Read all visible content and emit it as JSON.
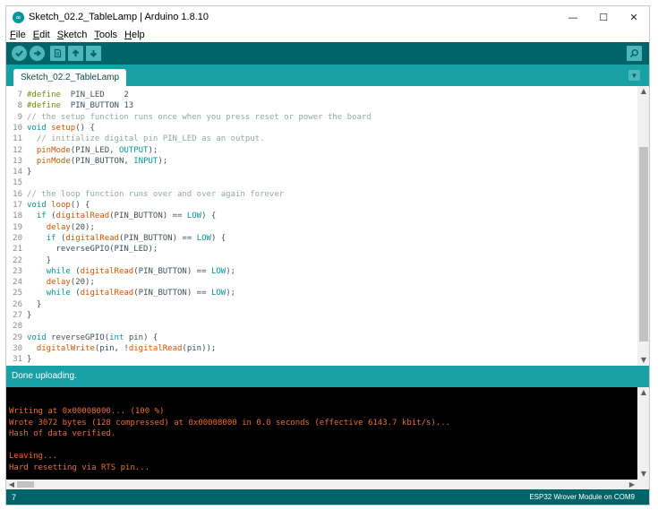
{
  "window": {
    "title": "Sketch_02.2_TableLamp | Arduino 1.8.10",
    "icon": "arduino-logo-icon",
    "controls": {
      "minimize": "—",
      "maximize": "☐",
      "close": "✕"
    }
  },
  "menubar": {
    "items": [
      {
        "ul": "F",
        "rest": "ile"
      },
      {
        "ul": "E",
        "rest": "dit"
      },
      {
        "ul": "S",
        "rest": "ketch"
      },
      {
        "ul": "T",
        "rest": "ools"
      },
      {
        "ul": "H",
        "rest": "elp"
      }
    ]
  },
  "toolbar": {
    "verify_icon": "checkmark-icon",
    "upload_icon": "arrow-right-icon",
    "new_icon": "new-file-icon",
    "open_icon": "arrow-up-icon",
    "save_icon": "arrow-down-icon",
    "serial_monitor_icon": "magnifier-icon"
  },
  "tabs": [
    {
      "label": "Sketch_02.2_TableLamp",
      "active": true
    }
  ],
  "editor": {
    "lines": [
      {
        "n": "7",
        "parts": [
          [
            "pp",
            "#define"
          ],
          [
            "",
            "  PIN_LED    2"
          ]
        ]
      },
      {
        "n": "8",
        "parts": [
          [
            "pp",
            "#define"
          ],
          [
            "",
            "  PIN_BUTTON 13"
          ]
        ]
      },
      {
        "n": "9",
        "parts": [
          [
            "c",
            "// the setup function runs once when you press reset or power the board"
          ]
        ]
      },
      {
        "n": "10",
        "parts": [
          [
            "k",
            "void"
          ],
          [
            "",
            " "
          ],
          [
            "f",
            "setup"
          ],
          [
            "",
            "() {"
          ]
        ]
      },
      {
        "n": "11",
        "parts": [
          [
            "c",
            "  // initialize digital pin PIN_LED as an output."
          ]
        ]
      },
      {
        "n": "12",
        "parts": [
          [
            "",
            "  "
          ],
          [
            "f",
            "pinMode"
          ],
          [
            "",
            "(PIN_LED, "
          ],
          [
            "k",
            "OUTPUT"
          ],
          [
            "",
            ");"
          ]
        ]
      },
      {
        "n": "13",
        "parts": [
          [
            "",
            "  "
          ],
          [
            "f",
            "pinMode"
          ],
          [
            "",
            "(PIN_BUTTON, "
          ],
          [
            "k",
            "INPUT"
          ],
          [
            "",
            ");"
          ]
        ]
      },
      {
        "n": "14",
        "parts": [
          [
            "",
            "}"
          ]
        ]
      },
      {
        "n": "15",
        "parts": []
      },
      {
        "n": "16",
        "parts": [
          [
            "c",
            "// the loop function runs over and over again forever"
          ]
        ]
      },
      {
        "n": "17",
        "parts": [
          [
            "k",
            "void"
          ],
          [
            "",
            " "
          ],
          [
            "f",
            "loop"
          ],
          [
            "",
            "() {"
          ]
        ]
      },
      {
        "n": "18",
        "parts": [
          [
            "",
            "  "
          ],
          [
            "k",
            "if"
          ],
          [
            "",
            " ("
          ],
          [
            "f",
            "digitalRead"
          ],
          [
            "",
            "(PIN_BUTTON) == "
          ],
          [
            "k",
            "LOW"
          ],
          [
            "",
            ") {"
          ]
        ]
      },
      {
        "n": "19",
        "parts": [
          [
            "",
            "    "
          ],
          [
            "f",
            "delay"
          ],
          [
            "",
            "(20);"
          ]
        ]
      },
      {
        "n": "20",
        "parts": [
          [
            "",
            "    "
          ],
          [
            "k",
            "if"
          ],
          [
            "",
            " ("
          ],
          [
            "f",
            "digitalRead"
          ],
          [
            "",
            "(PIN_BUTTON) == "
          ],
          [
            "k",
            "LOW"
          ],
          [
            "",
            ") {"
          ]
        ]
      },
      {
        "n": "21",
        "parts": [
          [
            "",
            "      reverseGPIO(PIN_LED);"
          ]
        ]
      },
      {
        "n": "22",
        "parts": [
          [
            "",
            "    }"
          ]
        ]
      },
      {
        "n": "23",
        "parts": [
          [
            "",
            "    "
          ],
          [
            "k",
            "while"
          ],
          [
            "",
            " ("
          ],
          [
            "f",
            "digitalRead"
          ],
          [
            "",
            "(PIN_BUTTON) == "
          ],
          [
            "k",
            "LOW"
          ],
          [
            "",
            ");"
          ]
        ]
      },
      {
        "n": "24",
        "parts": [
          [
            "",
            "    "
          ],
          [
            "f",
            "delay"
          ],
          [
            "",
            "(20);"
          ]
        ]
      },
      {
        "n": "25",
        "parts": [
          [
            "",
            "    "
          ],
          [
            "k",
            "while"
          ],
          [
            "",
            " ("
          ],
          [
            "f",
            "digitalRead"
          ],
          [
            "",
            "(PIN_BUTTON) == "
          ],
          [
            "k",
            "LOW"
          ],
          [
            "",
            ");"
          ]
        ]
      },
      {
        "n": "26",
        "parts": [
          [
            "",
            "  }"
          ]
        ]
      },
      {
        "n": "27",
        "parts": [
          [
            "",
            "}"
          ]
        ]
      },
      {
        "n": "28",
        "parts": []
      },
      {
        "n": "29",
        "parts": [
          [
            "k",
            "void"
          ],
          [
            "",
            " reverseGPIO("
          ],
          [
            "k",
            "int"
          ],
          [
            "",
            " pin) {"
          ]
        ]
      },
      {
        "n": "30",
        "parts": [
          [
            "",
            "  "
          ],
          [
            "f",
            "digitalWrite"
          ],
          [
            "",
            "(pin, !"
          ],
          [
            "f",
            "digitalRead"
          ],
          [
            "",
            "(pin));"
          ]
        ]
      },
      {
        "n": "31",
        "parts": [
          [
            "",
            "}"
          ]
        ]
      }
    ]
  },
  "status": {
    "message": "Done uploading."
  },
  "console": {
    "lines": [
      "Writing at 0x00008000... (100 %)",
      "Wrote 3072 bytes (128 compressed) at 0x00008000 in 0.0 seconds (effective 6143.7 kbit/s)...",
      "Hash of data verified.",
      "",
      "Leaving...",
      "Hard resetting via RTS pin..."
    ]
  },
  "footer": {
    "line_number": "7",
    "board": "ESP32 Wrover Module on COM9"
  },
  "colors": {
    "toolbar": "#006468",
    "tabbar": "#17a1a5",
    "console_text": "#ef6b2e",
    "keyword": "#00979c",
    "function": "#d35400",
    "preprocessor": "#728e00",
    "comment": "#95a5a6"
  }
}
